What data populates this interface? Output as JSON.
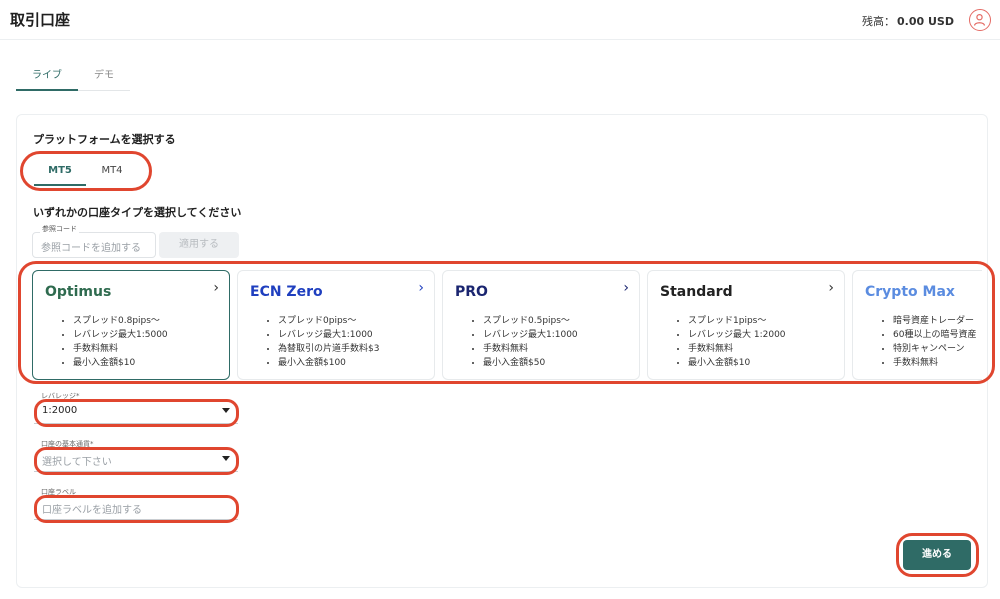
{
  "header": {
    "title": "取引口座",
    "balance_label": "残高：",
    "balance_value": "0.00 USD",
    "avatar_icon": "user-icon"
  },
  "env_tabs": [
    {
      "label": "ライブ",
      "active": true
    },
    {
      "label": "デモ",
      "active": false
    }
  ],
  "platform": {
    "heading": "プラットフォームを選択する",
    "tabs": [
      {
        "label": "MT5",
        "active": true
      },
      {
        "label": "MT4",
        "active": false
      }
    ]
  },
  "account_type": {
    "heading": "いずれかの口座タイプを選択してください"
  },
  "referral": {
    "legend": "参照コード",
    "placeholder": "参照コードを追加する",
    "apply_label": "適用する"
  },
  "cards": [
    {
      "title": "Optimus",
      "color": "#2f6b4f",
      "selected": true,
      "features": [
        "スプレッド0.8pips〜",
        "レバレッジ最大1:5000",
        "手数料無料",
        "最小入金額$10"
      ]
    },
    {
      "title": "ECN Zero",
      "color": "#1f3fbf",
      "selected": false,
      "features": [
        "スプレッド0pips〜",
        "レバレッジ最大1:1000",
        "為替取引の片道手数料$3",
        "最小入金額$100"
      ]
    },
    {
      "title": "PRO",
      "color": "#1a2570",
      "selected": false,
      "features": [
        "スプレッド0.5pips〜",
        "レバレッジ最大1:1000",
        "手数料無料",
        "最小入金額$50"
      ]
    },
    {
      "title": "Standard",
      "color": "#222222",
      "selected": false,
      "features": [
        "スプレッド1pips〜",
        "レバレッジ最大 1:2000",
        "手数料無料",
        "最小入金額$10"
      ]
    },
    {
      "title": "Crypto Max",
      "color": "#5b8ce0",
      "selected": false,
      "features": [
        "暗号資産トレーダー",
        "60種以上の暗号資産",
        "特別キャンペーン",
        "手数料無料"
      ]
    }
  ],
  "leverage": {
    "legend": "レバレッジ*",
    "value": "1:2000"
  },
  "currency": {
    "legend": "口座の基本通貨*",
    "placeholder": "選択して下さい"
  },
  "label_field": {
    "legend": "口座ラベル",
    "placeholder": "口座ラベルを追加する"
  },
  "next_label": "進める",
  "colors": {
    "accent": "#2f6b66",
    "highlight_ring": "#e0462f"
  }
}
